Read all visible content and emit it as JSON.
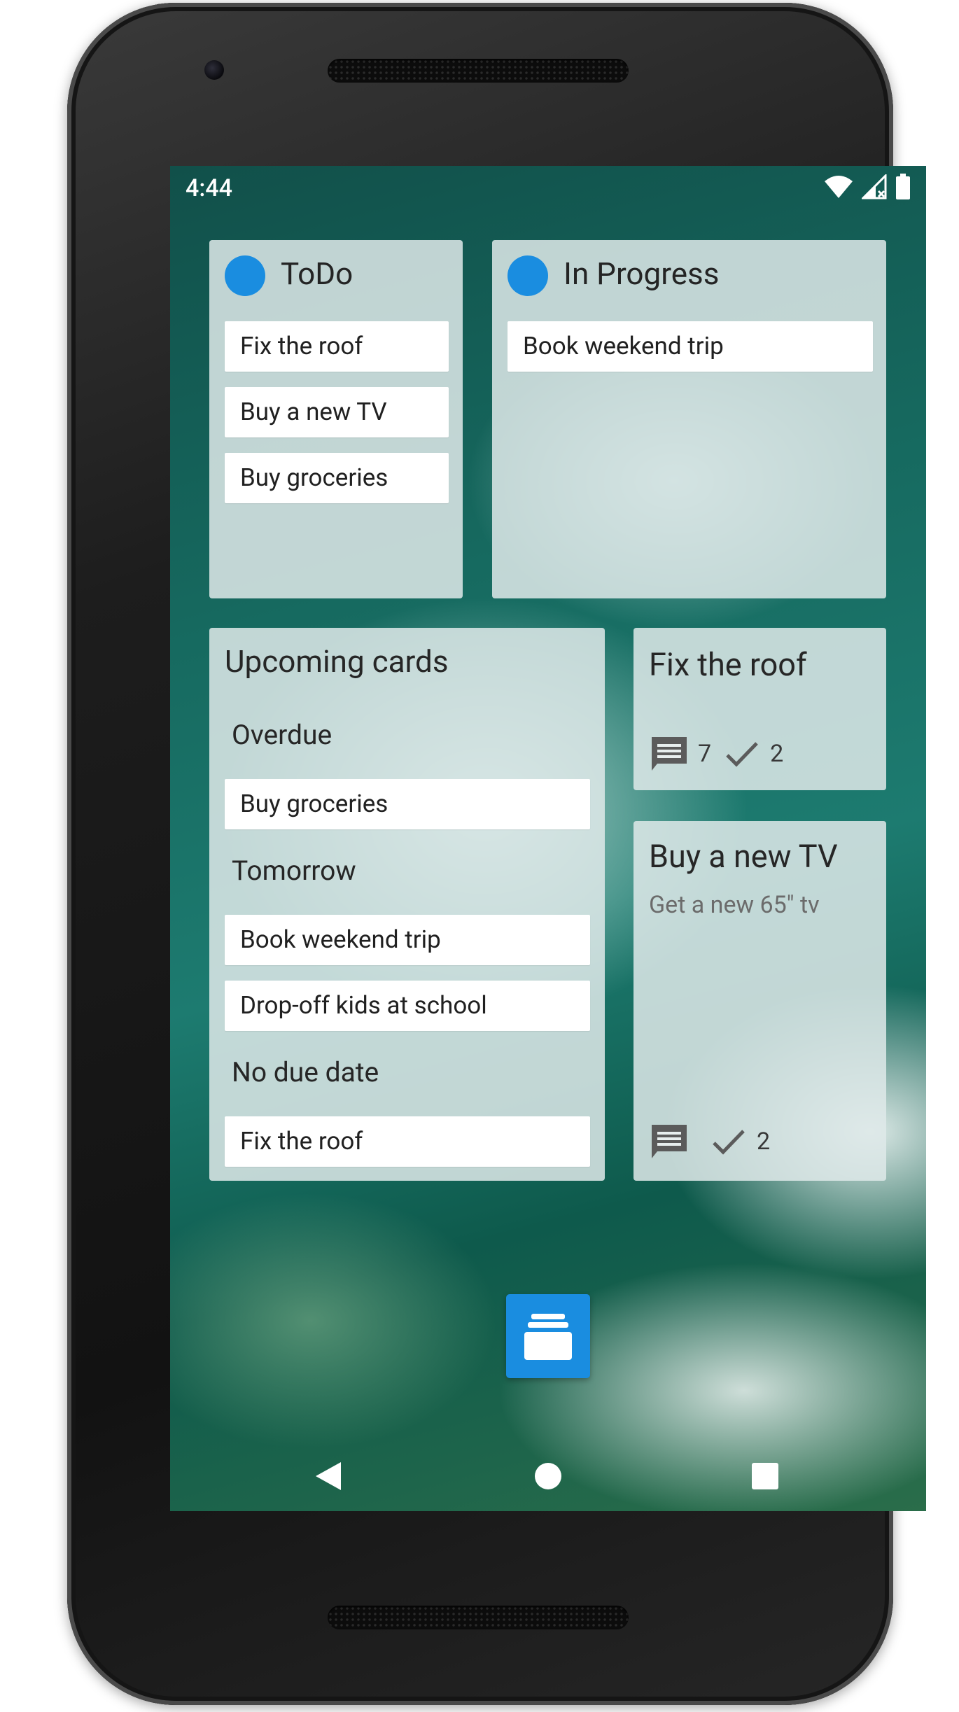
{
  "status_bar": {
    "time": "4:44"
  },
  "accent_color": "#1a8de0",
  "lists": [
    {
      "title": "ToDo",
      "items": [
        "Fix the roof",
        "Buy a new TV",
        "Buy groceries"
      ]
    },
    {
      "title": "In Progress",
      "items": [
        "Book weekend trip"
      ]
    }
  ],
  "upcoming": {
    "title": "Upcoming cards",
    "groups": [
      {
        "label": "Overdue",
        "items": [
          "Buy groceries"
        ]
      },
      {
        "label": "Tomorrow",
        "items": [
          "Book weekend trip",
          "Drop-off kids at school"
        ]
      },
      {
        "label": "No due date",
        "items": [
          "Fix the roof"
        ]
      }
    ]
  },
  "cards": [
    {
      "title": "Fix the roof",
      "description": "",
      "comments": "7",
      "checks": "2"
    },
    {
      "title": "Buy a new TV",
      "description": "Get a new 65\" tv",
      "comments": "",
      "checks": "2"
    }
  ],
  "icons": {
    "fab": "card-stack-icon",
    "nav": [
      "back-icon",
      "home-icon",
      "recents-icon"
    ],
    "status": [
      "wifi-icon",
      "signal-icon",
      "battery-icon"
    ]
  }
}
